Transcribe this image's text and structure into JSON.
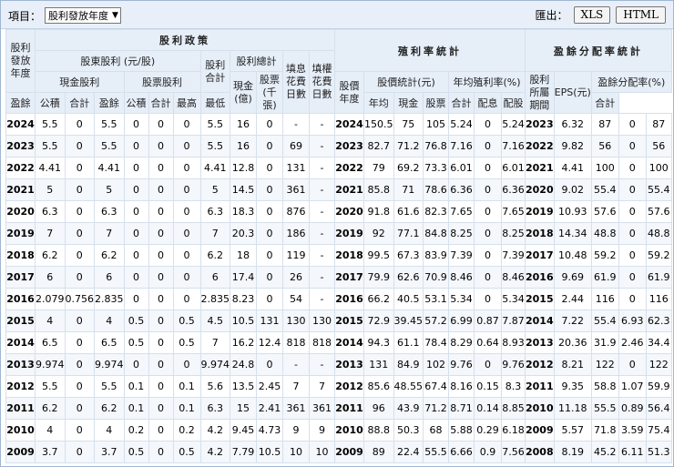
{
  "toolbar": {
    "item_label": "項目：",
    "select_value": "股利發放年度",
    "export_label": "匯出：",
    "xls": "XLS",
    "html": "HTML"
  },
  "headers": {
    "year_col": "股利發放年度",
    "dividend_policy": "股利政策",
    "shareholder_dividend": "股東股利 (元/股)",
    "cash_dividend": "現金股利",
    "stock_dividend": "股票股利",
    "surplus": "盈餘",
    "reserve": "公積",
    "total": "合計",
    "dividend_total": "股利合計",
    "dividend_summary": "股利總計",
    "cash_100m": "現金(億)",
    "stock_thousand": "股票(千張)",
    "fill_div_days": "填息花費日數",
    "fill_right_days": "填權花費日數",
    "yield_stats": "殖利率統計",
    "price_year": "股價年度",
    "price_stats": "股價統計(元)",
    "high": "最高",
    "low": "最低",
    "avg": "年均",
    "avg_yield": "年均殖利率(%)",
    "cash": "現金",
    "stock": "股票",
    "payout_stats": "盈餘分配率統計",
    "earn_period": "股利所屬期間",
    "eps": "EPS(元)",
    "payout_ratio": "盈餘分配率(%)",
    "allot": "配息",
    "share_allot": "配股"
  },
  "rows": [
    [
      "2024",
      "5.5",
      "0",
      "5.5",
      "0",
      "0",
      "0",
      "5.5",
      "16",
      "0",
      "-",
      "-",
      "2024",
      "150.5",
      "75",
      "105",
      "5.24",
      "0",
      "5.24",
      "2023",
      "6.32",
      "87",
      "0",
      "87"
    ],
    [
      "2023",
      "5.5",
      "0",
      "5.5",
      "0",
      "0",
      "0",
      "5.5",
      "16",
      "0",
      "69",
      "-",
      "2023",
      "82.7",
      "71.2",
      "76.8",
      "7.16",
      "0",
      "7.16",
      "2022",
      "9.82",
      "56",
      "0",
      "56"
    ],
    [
      "2022",
      "4.41",
      "0",
      "4.41",
      "0",
      "0",
      "0",
      "4.41",
      "12.8",
      "0",
      "131",
      "-",
      "2022",
      "79",
      "69.2",
      "73.3",
      "6.01",
      "0",
      "6.01",
      "2021",
      "4.41",
      "100",
      "0",
      "100"
    ],
    [
      "2021",
      "5",
      "0",
      "5",
      "0",
      "0",
      "0",
      "5",
      "14.5",
      "0",
      "361",
      "-",
      "2021",
      "85.8",
      "71",
      "78.6",
      "6.36",
      "0",
      "6.36",
      "2020",
      "9.02",
      "55.4",
      "0",
      "55.4"
    ],
    [
      "2020",
      "6.3",
      "0",
      "6.3",
      "0",
      "0",
      "0",
      "6.3",
      "18.3",
      "0",
      "876",
      "-",
      "2020",
      "91.8",
      "61.6",
      "82.3",
      "7.65",
      "0",
      "7.65",
      "2019",
      "10.93",
      "57.6",
      "0",
      "57.6"
    ],
    [
      "2019",
      "7",
      "0",
      "7",
      "0",
      "0",
      "0",
      "7",
      "20.3",
      "0",
      "186",
      "-",
      "2019",
      "92",
      "77.1",
      "84.8",
      "8.25",
      "0",
      "8.25",
      "2018",
      "14.34",
      "48.8",
      "0",
      "48.8"
    ],
    [
      "2018",
      "6.2",
      "0",
      "6.2",
      "0",
      "0",
      "0",
      "6.2",
      "18",
      "0",
      "119",
      "-",
      "2018",
      "99.5",
      "67.3",
      "83.9",
      "7.39",
      "0",
      "7.39",
      "2017",
      "10.48",
      "59.2",
      "0",
      "59.2"
    ],
    [
      "2017",
      "6",
      "0",
      "6",
      "0",
      "0",
      "0",
      "6",
      "17.4",
      "0",
      "26",
      "-",
      "2017",
      "79.9",
      "62.6",
      "70.9",
      "8.46",
      "0",
      "8.46",
      "2016",
      "9.69",
      "61.9",
      "0",
      "61.9"
    ],
    [
      "2016",
      "2.079",
      "0.756",
      "2.835",
      "0",
      "0",
      "0",
      "2.835",
      "8.23",
      "0",
      "54",
      "-",
      "2016",
      "66.2",
      "40.5",
      "53.1",
      "5.34",
      "0",
      "5.34",
      "2015",
      "2.44",
      "116",
      "0",
      "116"
    ],
    [
      "2015",
      "4",
      "0",
      "4",
      "0.5",
      "0",
      "0.5",
      "4.5",
      "10.5",
      "131",
      "130",
      "130",
      "2015",
      "72.9",
      "39.45",
      "57.2",
      "6.99",
      "0.87",
      "7.87",
      "2014",
      "7.22",
      "55.4",
      "6.93",
      "62.3"
    ],
    [
      "2014",
      "6.5",
      "0",
      "6.5",
      "0.5",
      "0",
      "0.5",
      "7",
      "16.2",
      "12.4",
      "818",
      "818",
      "2014",
      "94.3",
      "61.1",
      "78.4",
      "8.29",
      "0.64",
      "8.93",
      "2013",
      "20.36",
      "31.9",
      "2.46",
      "34.4"
    ],
    [
      "2013",
      "9.974",
      "0",
      "9.974",
      "0",
      "0",
      "0",
      "9.974",
      "24.8",
      "0",
      "-",
      "-",
      "2013",
      "131",
      "84.9",
      "102",
      "9.76",
      "0",
      "9.76",
      "2012",
      "8.21",
      "122",
      "0",
      "122"
    ],
    [
      "2012",
      "5.5",
      "0",
      "5.5",
      "0.1",
      "0",
      "0.1",
      "5.6",
      "13.5",
      "2.45",
      "7",
      "7",
      "2012",
      "85.6",
      "48.55",
      "67.4",
      "8.16",
      "0.15",
      "8.3",
      "2011",
      "9.35",
      "58.8",
      "1.07",
      "59.9"
    ],
    [
      "2011",
      "6.2",
      "0",
      "6.2",
      "0.1",
      "0",
      "0.1",
      "6.3",
      "15",
      "2.41",
      "361",
      "361",
      "2011",
      "96",
      "43.9",
      "71.2",
      "8.71",
      "0.14",
      "8.85",
      "2010",
      "11.18",
      "55.5",
      "0.89",
      "56.4"
    ],
    [
      "2010",
      "4",
      "0",
      "4",
      "0.2",
      "0",
      "0.2",
      "4.2",
      "9.45",
      "4.73",
      "9",
      "9",
      "2010",
      "88.8",
      "50.3",
      "68",
      "5.88",
      "0.29",
      "6.18",
      "2009",
      "5.57",
      "71.8",
      "3.59",
      "75.4"
    ],
    [
      "2009",
      "3.7",
      "0",
      "3.7",
      "0.5",
      "0",
      "0.5",
      "4.2",
      "7.79",
      "10.5",
      "10",
      "10",
      "2009",
      "89",
      "22.4",
      "55.5",
      "6.66",
      "0.9",
      "7.56",
      "2008",
      "8.19",
      "45.2",
      "6.11",
      "51.3"
    ]
  ]
}
